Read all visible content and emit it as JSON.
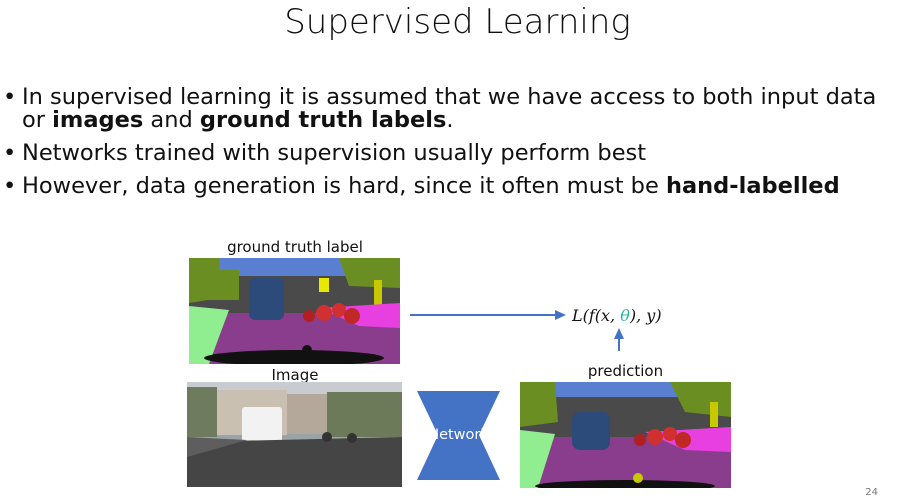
{
  "title": "Supervised Learning",
  "bullets": [
    {
      "text_a": "In supervised learning it is assumed that we have access to both input data",
      "text_b": "or ",
      "bold1": "images",
      "mid": " and ",
      "bold2": "ground truth labels",
      "end": "."
    },
    {
      "text": "Networks trained with supervision usually perform best"
    },
    {
      "text": "However, data generation is hard, since it often must be ",
      "bold": "hand-labelled"
    }
  ],
  "bullet_glyph": "•",
  "figure": {
    "gt_caption": "ground truth label",
    "image_caption": "Image",
    "prediction_caption": "prediction",
    "network_label": "Network",
    "loss": {
      "prefix": "L(f(x, ",
      "theta": "θ",
      "suffix": "), y)"
    }
  },
  "colors": {
    "arrow": "#4472c4",
    "network": "#4472c4",
    "theta": "#2bb5a0",
    "road": "#8b3d8d",
    "sidewalk": "#e840e0"
  },
  "page_number": "24"
}
